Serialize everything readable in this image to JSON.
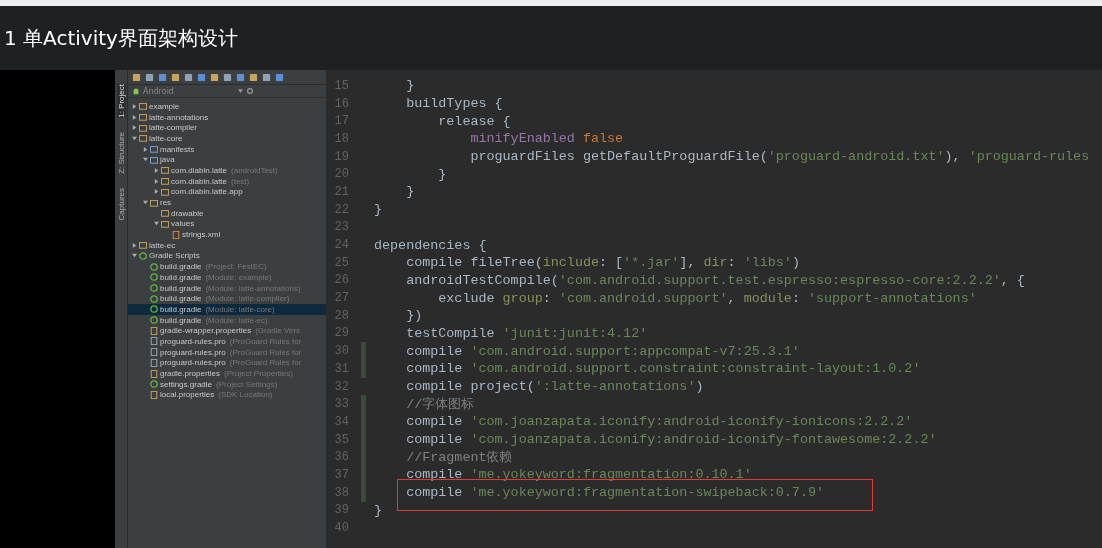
{
  "header": {
    "title": "1 单Activity界面架构设计"
  },
  "tool_tabs": [
    {
      "label": "1: Project",
      "selected": true
    },
    {
      "label": "Z: Structure",
      "selected": false
    },
    {
      "label": "Captures",
      "selected": false
    }
  ],
  "project_panel": {
    "view": "Android",
    "tree": [
      {
        "label": "example",
        "kind": "module",
        "expanded": false,
        "selected": false
      },
      {
        "label": "latte-annotations",
        "kind": "module",
        "expanded": false,
        "selected": false
      },
      {
        "label": "latte-compiler",
        "kind": "module",
        "expanded": false,
        "selected": false
      },
      {
        "label": "latte-core",
        "kind": "module",
        "expanded": true,
        "selected": false,
        "children": [
          {
            "label": "manifests",
            "kind": "folder",
            "expanded": false,
            "selected": false
          },
          {
            "label": "java",
            "kind": "folder",
            "expanded": true,
            "selected": false,
            "children": [
              {
                "label": "com.diabin.latte",
                "hint": "(androidTest)",
                "kind": "package",
                "expanded": false,
                "selected": false
              },
              {
                "label": "com.diabin.latte",
                "hint": "(test)",
                "kind": "package",
                "expanded": false,
                "selected": false
              },
              {
                "label": "com.diabin.latte.app",
                "kind": "package",
                "expanded": false,
                "selected": false
              }
            ]
          },
          {
            "label": "res",
            "kind": "resfolder",
            "expanded": true,
            "selected": false,
            "children": [
              {
                "label": "drawable",
                "kind": "package",
                "selected": false
              },
              {
                "label": "values",
                "kind": "package",
                "expanded": true,
                "selected": false,
                "children": [
                  {
                    "label": "strings.xml",
                    "kind": "xml",
                    "selected": false
                  }
                ]
              }
            ]
          }
        ]
      },
      {
        "label": "latte-ec",
        "kind": "module",
        "expanded": false,
        "selected": false
      },
      {
        "label": "Gradle Scripts",
        "kind": "gradle",
        "expanded": true,
        "selected": false,
        "children": [
          {
            "label": "build.gradle",
            "hint": "(Project: FestEC)",
            "kind": "gradle",
            "selected": false
          },
          {
            "label": "build.gradle",
            "hint": "(Module: example)",
            "kind": "gradle",
            "selected": false
          },
          {
            "label": "build.gradle",
            "hint": "(Module: latte-annotations)",
            "kind": "gradle",
            "selected": false
          },
          {
            "label": "build.gradle",
            "hint": "(Module: latte-compiler)",
            "kind": "gradle",
            "selected": false
          },
          {
            "label": "build.gradle",
            "hint": "(Module: latte-core)",
            "kind": "gradle",
            "selected": true
          },
          {
            "label": "build.gradle",
            "hint": "(Module: latte-ec)",
            "kind": "gradle",
            "selected": false
          },
          {
            "label": "gradle-wrapper.properties",
            "hint": "(Gradle Vers",
            "kind": "properties",
            "selected": false
          },
          {
            "label": "proguard-rules.pro",
            "hint": "(ProGuard Rules for",
            "kind": "file",
            "selected": false
          },
          {
            "label": "proguard-rules.pro",
            "hint": "(ProGuard Rules for",
            "kind": "file",
            "selected": false
          },
          {
            "label": "proguard-rules.pro",
            "hint": "(ProGuard Rules for",
            "kind": "file",
            "selected": false
          },
          {
            "label": "gradle.properties",
            "hint": "(Project Properties)",
            "kind": "properties",
            "selected": false
          },
          {
            "label": "settings.gradle",
            "hint": "(Project Settings)",
            "kind": "gradle",
            "selected": false
          },
          {
            "label": "local.properties",
            "hint": "(SDK Location)",
            "kind": "properties",
            "selected": false
          }
        ]
      }
    ]
  },
  "editor": {
    "lines": [
      {
        "number": "15",
        "changed": false,
        "boxed": false,
        "segments": [
          {
            "kind": "plain",
            "text": "    }"
          }
        ]
      },
      {
        "number": "16",
        "changed": false,
        "boxed": false,
        "segments": [
          {
            "kind": "plain",
            "text": "    buildTypes {"
          }
        ]
      },
      {
        "number": "17",
        "changed": false,
        "boxed": false,
        "segments": [
          {
            "kind": "plain",
            "text": "        release {"
          }
        ]
      },
      {
        "number": "18",
        "changed": false,
        "boxed": false,
        "segments": [
          {
            "kind": "property",
            "text": "            minifyEnabled "
          },
          {
            "kind": "keyword",
            "text": "false"
          }
        ]
      },
      {
        "number": "19",
        "changed": false,
        "boxed": false,
        "segments": [
          {
            "kind": "plain",
            "text": "            proguardFiles getDefaultProguardFile("
          },
          {
            "kind": "string",
            "text": "'proguard-android.txt'"
          },
          {
            "kind": "plain",
            "text": "), "
          },
          {
            "kind": "string",
            "text": "'proguard-rules"
          }
        ]
      },
      {
        "number": "20",
        "changed": false,
        "boxed": false,
        "segments": [
          {
            "kind": "plain",
            "text": "        }"
          }
        ]
      },
      {
        "number": "21",
        "changed": false,
        "boxed": false,
        "segments": [
          {
            "kind": "plain",
            "text": "    }"
          }
        ]
      },
      {
        "number": "22",
        "changed": false,
        "boxed": false,
        "segments": [
          {
            "kind": "plain",
            "text": "}"
          }
        ]
      },
      {
        "number": "23",
        "changed": false,
        "boxed": false
      },
      {
        "number": "24",
        "changed": false,
        "boxed": false,
        "segments": [
          {
            "kind": "plain",
            "text": "dependencies {"
          }
        ]
      },
      {
        "number": "25",
        "changed": false,
        "boxed": false,
        "segments": [
          {
            "kind": "plain",
            "text": "    compile fileTree("
          },
          {
            "kind": "named",
            "text": "include"
          },
          {
            "kind": "plain",
            "text": ": ["
          },
          {
            "kind": "string",
            "text": "'*.jar'"
          },
          {
            "kind": "plain",
            "text": "], "
          },
          {
            "kind": "named",
            "text": "dir"
          },
          {
            "kind": "plain",
            "text": ": "
          },
          {
            "kind": "string",
            "text": "'libs'"
          },
          {
            "kind": "plain",
            "text": ")"
          }
        ]
      },
      {
        "number": "26",
        "changed": false,
        "boxed": false,
        "segments": [
          {
            "kind": "plain",
            "text": "    androidTestCompile("
          },
          {
            "kind": "string",
            "text": "'com.android.support.test.espresso:espresso-core:2.2.2'"
          },
          {
            "kind": "plain",
            "text": ", {"
          }
        ]
      },
      {
        "number": "27",
        "changed": false,
        "boxed": false,
        "segments": [
          {
            "kind": "plain",
            "text": "        exclude "
          },
          {
            "kind": "named",
            "text": "group"
          },
          {
            "kind": "plain",
            "text": ": "
          },
          {
            "kind": "string",
            "text": "'com.android.support'"
          },
          {
            "kind": "plain",
            "text": ", "
          },
          {
            "kind": "named",
            "text": "module"
          },
          {
            "kind": "plain",
            "text": ": "
          },
          {
            "kind": "string",
            "text": "'support-annotations'"
          }
        ]
      },
      {
        "number": "28",
        "changed": false,
        "boxed": false,
        "segments": [
          {
            "kind": "plain",
            "text": "    })"
          }
        ]
      },
      {
        "number": "29",
        "changed": false,
        "boxed": false,
        "segments": [
          {
            "kind": "plain",
            "text": "    testCompile "
          },
          {
            "kind": "string",
            "text": "'junit:junit:4.12'"
          }
        ]
      },
      {
        "number": "30",
        "changed": true,
        "boxed": false,
        "segments": [
          {
            "kind": "plain",
            "text": "    compile "
          },
          {
            "kind": "string",
            "text": "'com.android.support:appcompat-v7:25.3.1'"
          }
        ]
      },
      {
        "number": "31",
        "changed": true,
        "boxed": false,
        "segments": [
          {
            "kind": "plain",
            "text": "    compile "
          },
          {
            "kind": "string",
            "text": "'com.android.support.constraint:constraint-layout:1.0.2'"
          }
        ]
      },
      {
        "number": "32",
        "changed": false,
        "boxed": false,
        "segments": [
          {
            "kind": "plain",
            "text": "    compile project("
          },
          {
            "kind": "string",
            "text": "':latte-annotations'"
          },
          {
            "kind": "plain",
            "text": ")"
          }
        ]
      },
      {
        "number": "33",
        "changed": true,
        "boxed": false,
        "segments": [
          {
            "kind": "comment",
            "text": "    //字体图标"
          }
        ]
      },
      {
        "number": "34",
        "changed": true,
        "boxed": false,
        "segments": [
          {
            "kind": "plain",
            "text": "    compile "
          },
          {
            "kind": "string",
            "text": "'com.joanzapata.iconify:android-iconify-ionicons:2.2.2'"
          }
        ]
      },
      {
        "number": "35",
        "changed": true,
        "boxed": false,
        "segments": [
          {
            "kind": "plain",
            "text": "    compile "
          },
          {
            "kind": "string",
            "text": "'com.joanzapata.iconify:android-iconify-fontawesome:2.2.2'"
          }
        ]
      },
      {
        "number": "36",
        "changed": true,
        "boxed": false,
        "segments": [
          {
            "kind": "comment",
            "text": "    //Fragment依赖"
          }
        ]
      },
      {
        "number": "37",
        "changed": true,
        "boxed": false,
        "segments": [
          {
            "kind": "plain",
            "text": "    compile "
          },
          {
            "kind": "string",
            "text": "'me.yokeyword:fragmentation:0.10.1'"
          }
        ]
      },
      {
        "number": "38",
        "changed": true,
        "boxed": true,
        "segments": [
          {
            "kind": "plain",
            "text": "    compile "
          },
          {
            "kind": "string",
            "text": "'me.yokeyword:fragmentation-swipeback:0.7.9'"
          }
        ]
      },
      {
        "number": "39",
        "changed": false,
        "boxed": false,
        "segments": [
          {
            "kind": "plain",
            "text": "}"
          }
        ]
      },
      {
        "number": "40",
        "changed": false,
        "boxed": false
      }
    ]
  }
}
